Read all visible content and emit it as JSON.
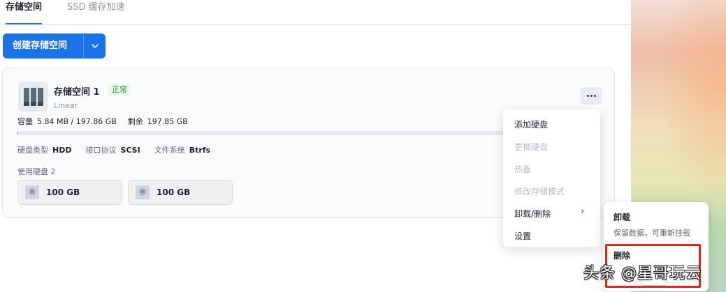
{
  "tabs": [
    {
      "label": "存储空间"
    },
    {
      "label": "SSD 缓存加速"
    }
  ],
  "toolbar": {
    "create_label": "创建存储空间",
    "split_icon": "chevron-down-icon"
  },
  "pool": {
    "name": "存储空间 1",
    "status": "正常",
    "type": "Linear",
    "capacity_label": "容量",
    "capacity_value": "5.84 MB / 197.86 GB",
    "remaining_label": "剩余",
    "remaining_value": "197.85 GB",
    "usage_fraction": 3e-05,
    "disk_type_label": "硬盘类型",
    "disk_type_value": "HDD",
    "interface_label": "接口协议",
    "interface_value": "SCSI",
    "fs_label": "文件系统",
    "fs_value": "Btrfs",
    "disks_label": "使用硬盘 2",
    "disks": [
      {
        "size": "100 GB"
      },
      {
        "size": "100 GB"
      }
    ]
  },
  "menu": {
    "items": [
      {
        "label": "添加硬盘",
        "disabled": false
      },
      {
        "label": "更换硬盘",
        "disabled": true
      },
      {
        "label": "热备",
        "disabled": true
      },
      {
        "label": "修改存储模式",
        "disabled": true
      },
      {
        "label": "卸载/删除",
        "disabled": false
      },
      {
        "label": "设置",
        "disabled": false
      }
    ],
    "submenu_chevron": "›"
  },
  "submenu": {
    "unmount_title": "卸载",
    "unmount_desc": "保留数据，可重新挂载",
    "delete_title": "删除"
  },
  "watermark": "头条 @星哥玩云",
  "colors": {
    "accent": "#1a73e8",
    "status_ok": "#2ea043",
    "highlight": "#e1251b"
  }
}
